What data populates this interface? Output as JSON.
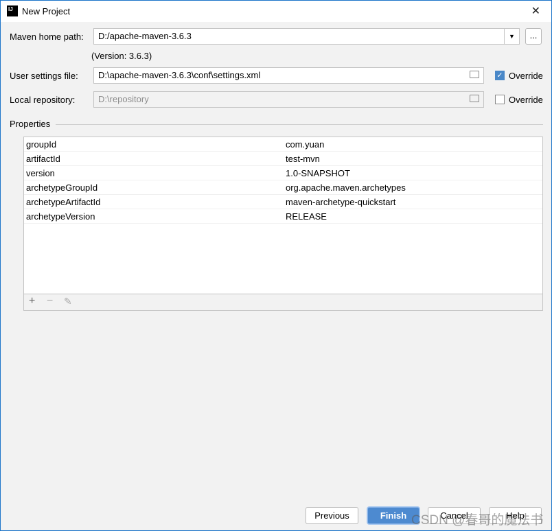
{
  "window": {
    "title": "New Project",
    "logo": "IJ"
  },
  "form": {
    "maven_home_label": "Maven home path:",
    "maven_home_value": "D:/apache-maven-3.6.3",
    "version": "(Version: 3.6.3)",
    "browse": "...",
    "user_settings_label": "User settings file:",
    "user_settings_value": "D:\\apache-maven-3.6.3\\conf\\settings.xml",
    "user_override": "Override",
    "user_override_checked": true,
    "local_repo_label": "Local repository:",
    "local_repo_value": "D:\\repository",
    "local_override": "Override",
    "local_override_checked": false
  },
  "properties": {
    "label": "Properties",
    "rows": [
      {
        "key": "groupId",
        "value": "com.yuan"
      },
      {
        "key": "artifactId",
        "value": "test-mvn"
      },
      {
        "key": "version",
        "value": "1.0-SNAPSHOT"
      },
      {
        "key": "archetypeGroupId",
        "value": "org.apache.maven.archetypes"
      },
      {
        "key": "archetypeArtifactId",
        "value": "maven-archetype-quickstart"
      },
      {
        "key": "archetypeVersion",
        "value": "RELEASE"
      }
    ],
    "toolbar": [
      "add-icon",
      "remove-icon",
      "edit-icon"
    ]
  },
  "buttons": {
    "previous": "Previous",
    "finish": "Finish",
    "cancel": "Cancel",
    "help": "Help"
  },
  "watermark": "CSDN @春哥的魔法书"
}
